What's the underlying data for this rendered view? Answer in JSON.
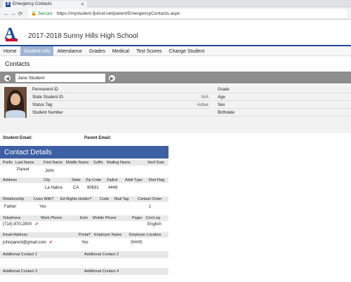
{
  "browser": {
    "tab_title": "Emergency Contacts",
    "secure_label": "Secure",
    "url": "https://mystudent.fjuhsd.net/parent/EmergencyContacts.aspx"
  },
  "header": {
    "year": "2017-2018",
    "school": "Sunny Hills High School",
    "logo_letter": "A"
  },
  "menu": {
    "items": [
      "Home",
      "Student Info",
      "Attendance",
      "Grades",
      "Medical",
      "Test Scores",
      "Change Student"
    ],
    "active": "Student Info"
  },
  "page_title": "Contacts",
  "student_selector": {
    "value": "Jane Student"
  },
  "student_info": {
    "left": [
      {
        "label": "Permanent ID",
        "value": ""
      },
      {
        "label": "State Student ID",
        "value": "N/A"
      },
      {
        "label": "Status Tag",
        "value": "Active"
      },
      {
        "label": "Student Number",
        "value": ""
      }
    ],
    "right": [
      "Grade",
      "Age",
      "Sex",
      "Birthdate"
    ]
  },
  "emails": {
    "student": "Student Email:",
    "parent": "Parent Email:"
  },
  "contact_details": {
    "title": "Contact Details",
    "row1_headers": [
      "Prefix",
      "Last Name",
      "First Name",
      "Middle Name",
      "Suffix",
      "Mailing Name",
      "Verif Date"
    ],
    "row1_values": [
      "Parent",
      "John"
    ],
    "row2_headers": [
      "Address",
      "City",
      "State",
      "Zip Code",
      "ZipExt",
      "Addr Type",
      "Red Flag"
    ],
    "row2_values": [
      "La Habra",
      "CA",
      "90631",
      "4449"
    ],
    "row3_headers": [
      "Relationship",
      "Lives With?",
      "Ed Rights Holder?",
      "Code",
      "Mail Tag",
      "Contact Order"
    ],
    "row3_values": [
      "Father",
      "Yes",
      "1"
    ],
    "row4_headers": [
      "Telephone",
      "Work Phone",
      "Extn",
      "Mobile Phone",
      "Pager",
      "CorrLng"
    ],
    "row4_values": [
      "(714) 870-2800",
      "English"
    ],
    "row5_headers": [
      "Email Address",
      "Portal?",
      "Employer Name",
      "Employer Location"
    ],
    "row5_values": [
      "johnparent@gmail.com",
      "Yes",
      "SHHS"
    ],
    "additional": [
      "Additional Contact 1",
      "Additional Contact 2",
      "Additional Contact 3",
      "Additional Contact 4"
    ],
    "check_glyph": "✔"
  }
}
